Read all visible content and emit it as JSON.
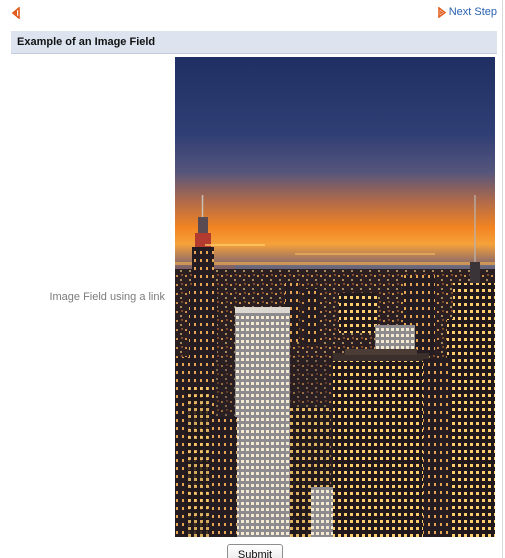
{
  "nav": {
    "back_icon": "back-arrow-icon",
    "next_icon": "next-arrow-icon",
    "next_label": "Next Step",
    "accent_color": "#e05a1a",
    "link_color": "#2a62b0"
  },
  "section": {
    "title": "Example of an Image Field",
    "header_color": "#dde4f0"
  },
  "field": {
    "label": "Image Field using a link",
    "image_alt": "city skyline at dusk"
  },
  "form": {
    "submit_label": "Submit"
  }
}
